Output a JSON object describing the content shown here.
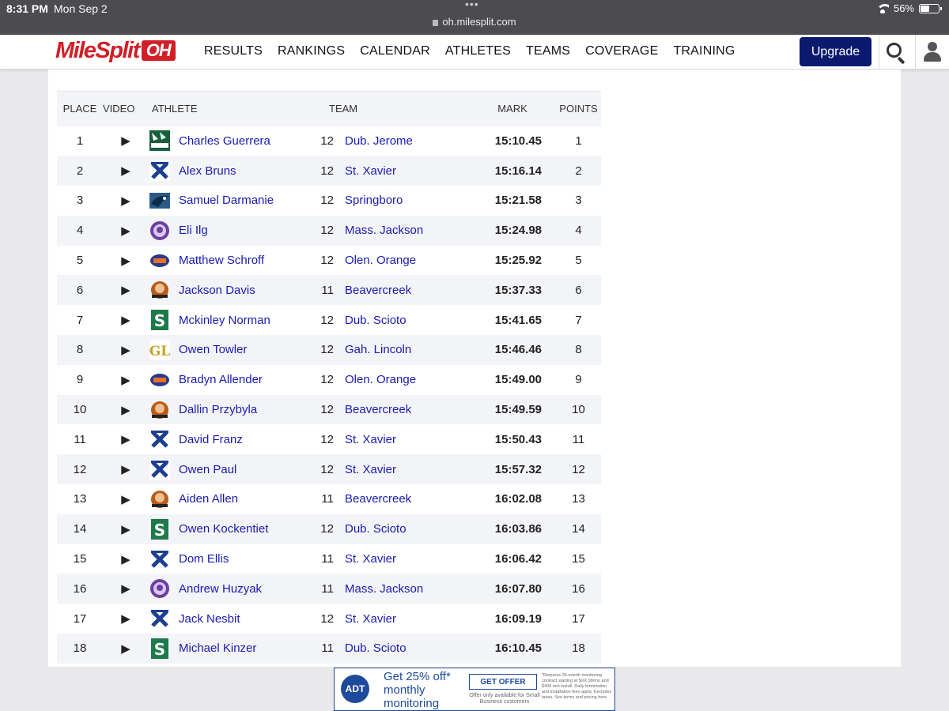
{
  "status_bar": {
    "time": "8:31 PM",
    "date": "Mon Sep 2",
    "url": "oh.milesplit.com",
    "battery": "56%",
    "battery_level": 0.56
  },
  "header": {
    "logo_text": "MileSplit",
    "logo_state": "OH",
    "nav": [
      "RESULTS",
      "RANKINGS",
      "CALENDAR",
      "ATHLETES",
      "TEAMS",
      "COVERAGE",
      "TRAINING"
    ],
    "upgrade_label": "Upgrade",
    "brand_color": "#d21f27",
    "accent_color": "#0b1a6e"
  },
  "table": {
    "headers": {
      "place": "PLACE",
      "video": "VIDEO",
      "athlete": "ATHLETE",
      "team": "TEAM",
      "mark": "MARK",
      "points": "POINTS"
    },
    "video_glyph": "▶",
    "rows": [
      {
        "place": "1",
        "athlete": "Charles Guerrera",
        "grade": "12",
        "team": "Dub. Jerome",
        "mark": "15:10.45",
        "points": "1",
        "logo": "celtics"
      },
      {
        "place": "2",
        "athlete": "Alex Bruns",
        "grade": "12",
        "team": "St. Xavier",
        "mark": "15:16.14",
        "points": "2",
        "logo": "xavier"
      },
      {
        "place": "3",
        "athlete": "Samuel Darmanie",
        "grade": "12",
        "team": "Springboro",
        "mark": "15:21.58",
        "points": "3",
        "logo": "panther"
      },
      {
        "place": "4",
        "athlete": "Eli Ilg",
        "grade": "12",
        "team": "Mass. Jackson",
        "mark": "15:24.98",
        "points": "4",
        "logo": "jackson"
      },
      {
        "place": "5",
        "athlete": "Matthew Schroff",
        "grade": "12",
        "team": "Olen. Orange",
        "mark": "15:25.92",
        "points": "5",
        "logo": "orange"
      },
      {
        "place": "6",
        "athlete": "Jackson Davis",
        "grade": "11",
        "team": "Beavercreek",
        "mark": "15:37.33",
        "points": "6",
        "logo": "beaver"
      },
      {
        "place": "7",
        "athlete": "Mckinley Norman",
        "grade": "12",
        "team": "Dub. Scioto",
        "mark": "15:41.65",
        "points": "7",
        "logo": "scioto"
      },
      {
        "place": "8",
        "athlete": "Owen Towler",
        "grade": "12",
        "team": "Gah. Lincoln",
        "mark": "15:46.46",
        "points": "8",
        "logo": "lincoln"
      },
      {
        "place": "9",
        "athlete": "Bradyn Allender",
        "grade": "12",
        "team": "Olen. Orange",
        "mark": "15:49.00",
        "points": "9",
        "logo": "orange"
      },
      {
        "place": "10",
        "athlete": "Dallin Przybyla",
        "grade": "12",
        "team": "Beavercreek",
        "mark": "15:49.59",
        "points": "10",
        "logo": "beaver"
      },
      {
        "place": "11",
        "athlete": "David Franz",
        "grade": "12",
        "team": "St. Xavier",
        "mark": "15:50.43",
        "points": "11",
        "logo": "xavier"
      },
      {
        "place": "12",
        "athlete": "Owen Paul",
        "grade": "12",
        "team": "St. Xavier",
        "mark": "15:57.32",
        "points": "12",
        "logo": "xavier"
      },
      {
        "place": "13",
        "athlete": "Aiden Allen",
        "grade": "11",
        "team": "Beavercreek",
        "mark": "16:02.08",
        "points": "13",
        "logo": "beaver"
      },
      {
        "place": "14",
        "athlete": "Owen Kockentiet",
        "grade": "12",
        "team": "Dub. Scioto",
        "mark": "16:03.86",
        "points": "14",
        "logo": "scioto"
      },
      {
        "place": "15",
        "athlete": "Dom Ellis",
        "grade": "11",
        "team": "St. Xavier",
        "mark": "16:06.42",
        "points": "15",
        "logo": "xavier"
      },
      {
        "place": "16",
        "athlete": "Andrew Huzyak",
        "grade": "11",
        "team": "Mass. Jackson",
        "mark": "16:07.80",
        "points": "16",
        "logo": "jackson"
      },
      {
        "place": "17",
        "athlete": "Jack Nesbit",
        "grade": "12",
        "team": "St. Xavier",
        "mark": "16:09.19",
        "points": "17",
        "logo": "xavier"
      },
      {
        "place": "18",
        "athlete": "Michael Kinzer",
        "grade": "11",
        "team": "Dub. Scioto",
        "mark": "16:10.45",
        "points": "18",
        "logo": "scioto"
      }
    ]
  },
  "ad": {
    "brand": "ADT",
    "headline": "Get 25% off* monthly monitoring",
    "cta": "GET OFFER",
    "sub": "Offer only available for Small Business customers",
    "fine_print": "*Requires 36-month monitoring contract starting at $XX.99/mo and $499 min install. Daily termination and installation fees apply. Excludes taxes. See terms and pricing here."
  }
}
